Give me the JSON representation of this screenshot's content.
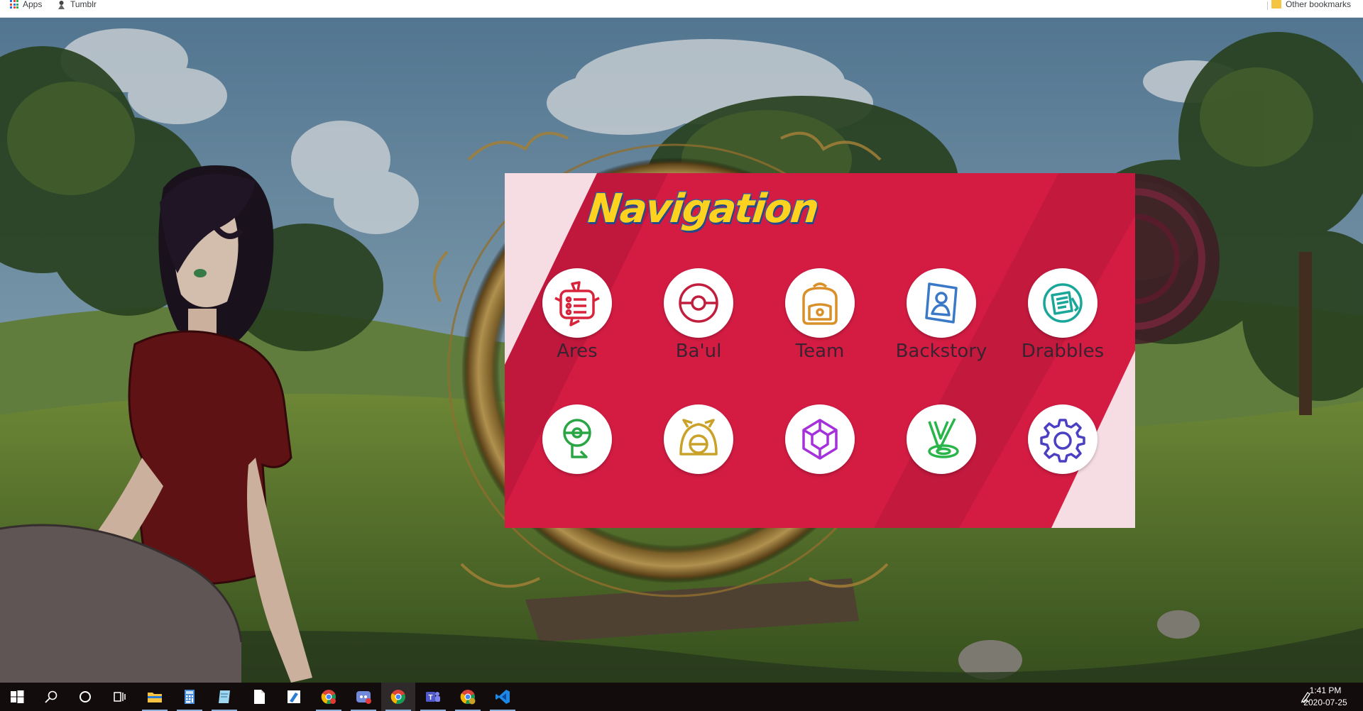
{
  "bookmarks_bar": {
    "items": [
      {
        "label": "Apps",
        "icon": "apps-grid-icon"
      },
      {
        "label": "Tumblr",
        "icon": "tumblr-icon"
      }
    ],
    "other_bookmarks": {
      "label": "Other bookmarks",
      "icon": "folder-icon"
    }
  },
  "navigation_panel": {
    "title": "Navigation",
    "colors": {
      "panel": "#d41c43",
      "accent_stripe": "#b8173a",
      "corner": "#f6dde4",
      "title_fill": "#ffd21f",
      "title_outline": "#2f5ea8"
    },
    "items": [
      {
        "label": "Ares",
        "icon": "rotom-phone-icon",
        "color": "#d8243b"
      },
      {
        "label": "Ba'ul",
        "icon": "pokeball-icon",
        "color": "#c01e3c"
      },
      {
        "label": "Team",
        "icon": "backpack-icon",
        "color": "#d9902a"
      },
      {
        "label": "Backstory",
        "icon": "trainer-card-icon",
        "color": "#3a78c8"
      },
      {
        "label": "Drabbles",
        "icon": "notes-icon",
        "color": "#1aa79a"
      },
      {
        "label": "",
        "icon": "map-pin-icon",
        "color": "#2aa544"
      },
      {
        "label": "",
        "icon": "pokeball-camp-icon",
        "color": "#c9a227"
      },
      {
        "label": "",
        "icon": "gem-icon",
        "color": "#a431d9"
      },
      {
        "label": "",
        "icon": "target-check-icon",
        "color": "#2ab54a"
      },
      {
        "label": "",
        "icon": "settings-gear-icon",
        "color": "#4b3fc4"
      }
    ]
  },
  "taskbar": {
    "items": [
      {
        "name": "start-button",
        "icon": "windows-logo-icon"
      },
      {
        "name": "search-button",
        "icon": "search-icon"
      },
      {
        "name": "cortana-button",
        "icon": "cortana-icon"
      },
      {
        "name": "task-view-button",
        "icon": "task-view-icon"
      },
      {
        "name": "file-explorer-button",
        "icon": "folder-icon"
      },
      {
        "name": "calculator-button",
        "icon": "calculator-icon"
      },
      {
        "name": "notepad-button",
        "icon": "notepad-icon"
      },
      {
        "name": "blank-document-button",
        "icon": "document-icon"
      },
      {
        "name": "paint-button",
        "icon": "paint-icon"
      },
      {
        "name": "chrome-profile-button",
        "icon": "chrome-icon"
      },
      {
        "name": "discord-button",
        "icon": "discord-icon"
      },
      {
        "name": "chrome-button",
        "icon": "chrome-icon"
      },
      {
        "name": "teams-button",
        "icon": "teams-icon"
      },
      {
        "name": "chrome-alt-button",
        "icon": "chrome-icon"
      },
      {
        "name": "vscode-button",
        "icon": "vscode-icon"
      }
    ],
    "clock": {
      "time": "1:41 PM",
      "date": "2020-07-25"
    },
    "pen_icon": "pen-workspace-icon"
  }
}
